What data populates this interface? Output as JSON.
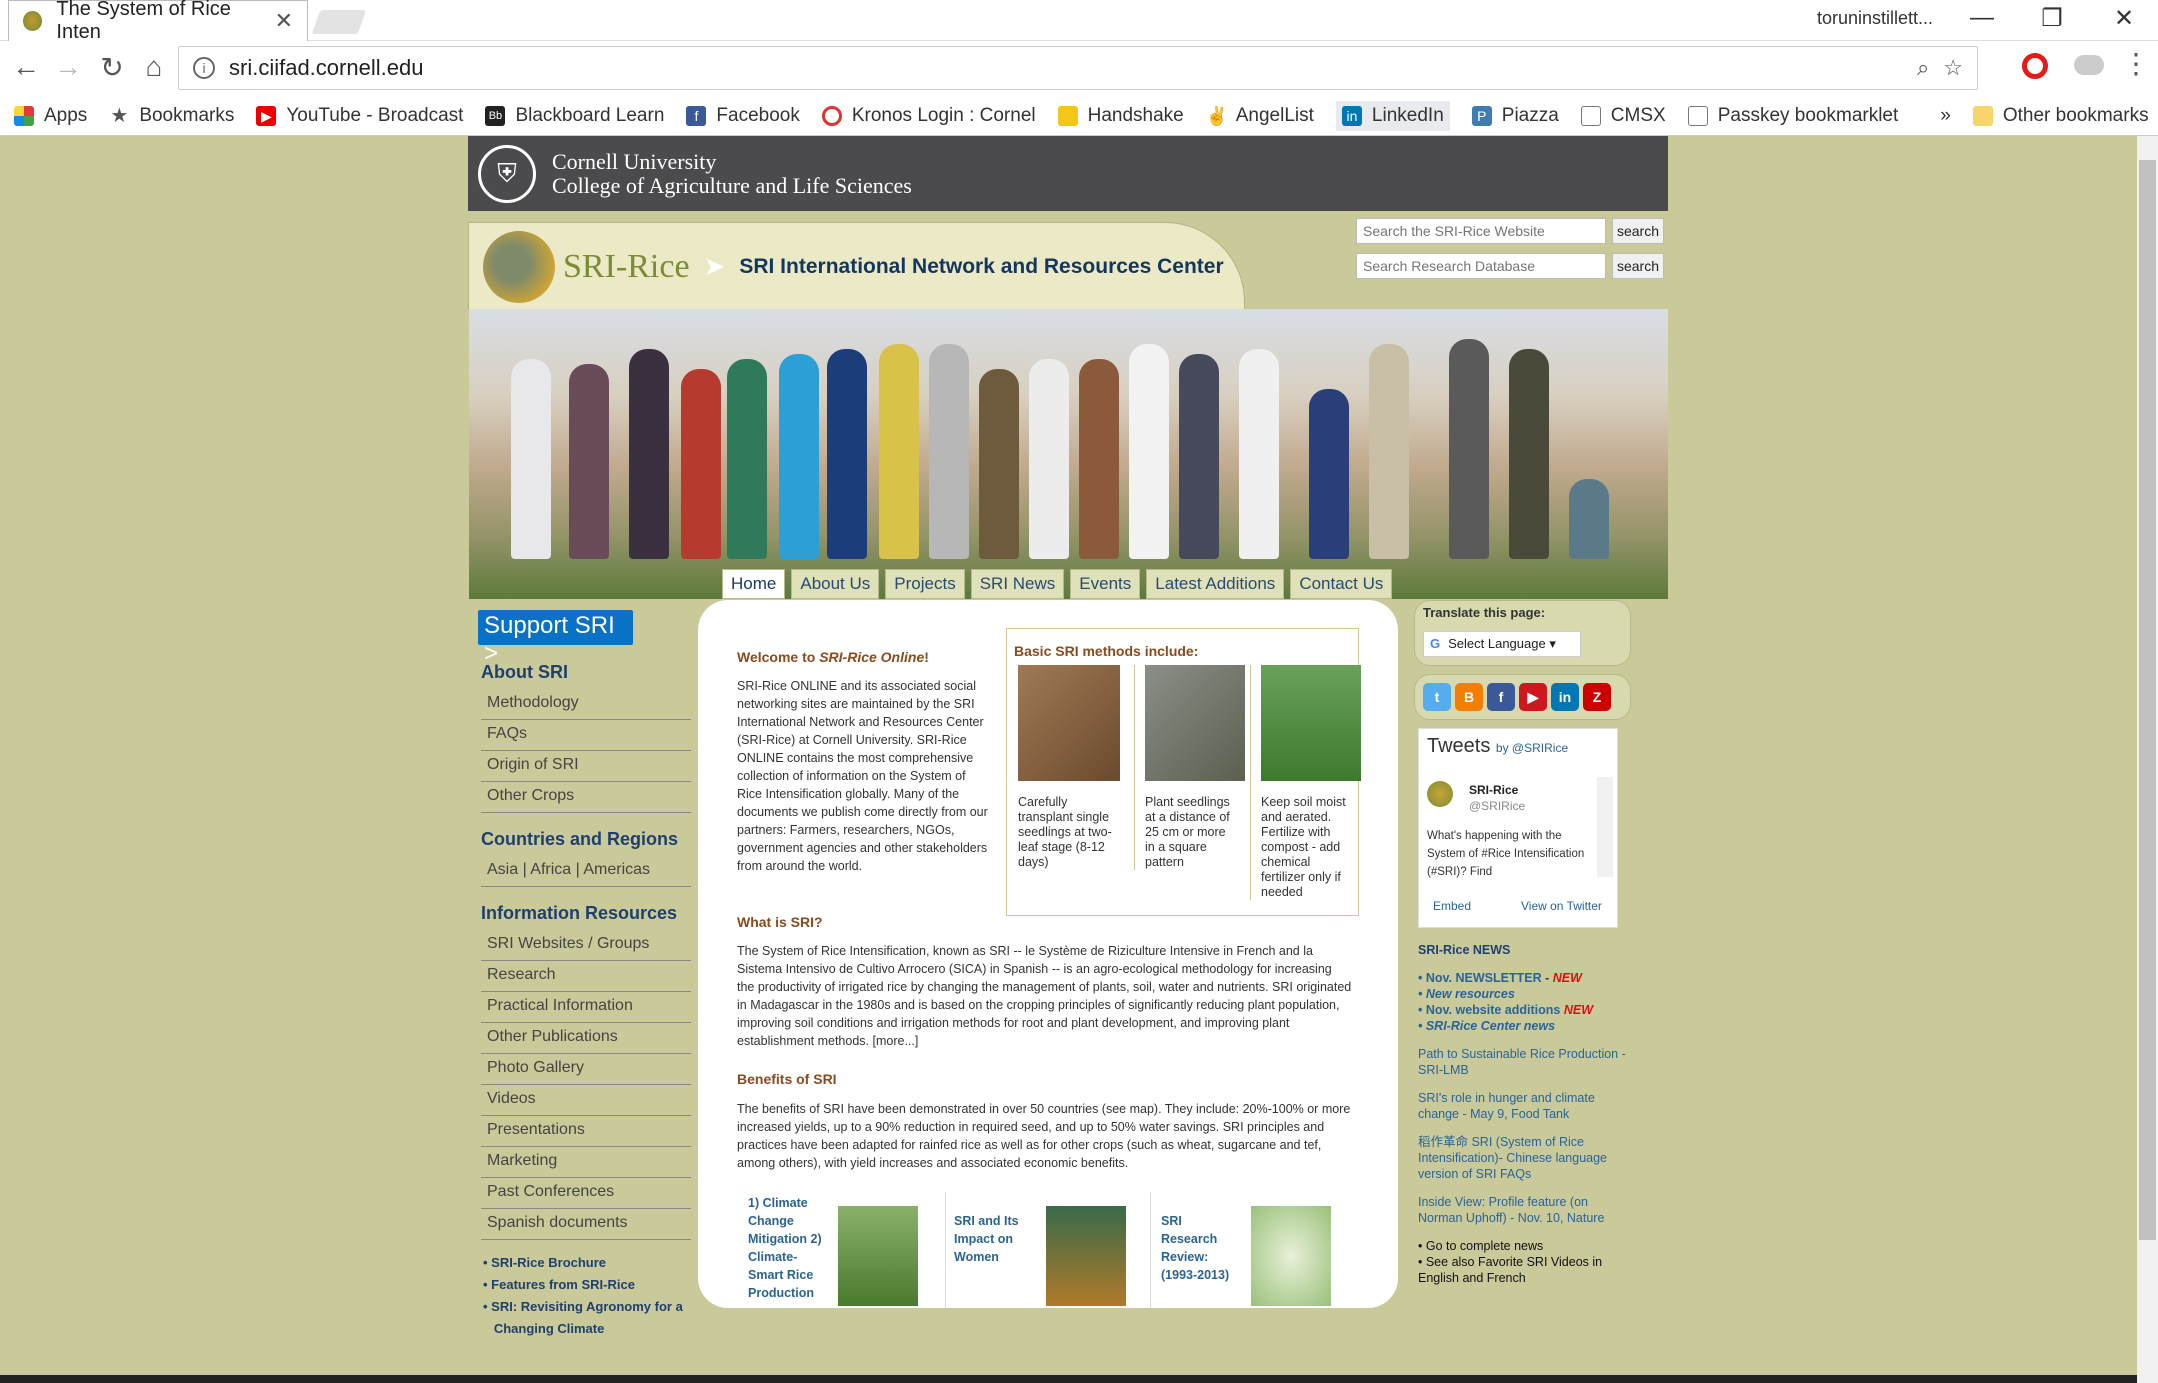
{
  "browser": {
    "tab_title": "The System of Rice Inten",
    "user": "toruninstillett...",
    "url": "sri.ciifad.cornell.edu",
    "bookmarks": [
      "Apps",
      "Bookmarks",
      "YouTube - Broadcast",
      "Blackboard Learn",
      "Facebook",
      "Kronos Login : Cornel",
      "Handshake",
      "AngelList",
      "LinkedIn",
      "Piazza",
      "CMSX",
      "Passkey bookmarklet"
    ],
    "other_bookmarks": "Other bookmarks"
  },
  "cornell": {
    "line1": "Cornell University",
    "line2": "College of Agriculture and Life Sciences"
  },
  "header": {
    "logo": "SRI-Rice",
    "title": "SRI International Network and Resources Center"
  },
  "search": {
    "site_placeholder": "Search the SRI-Rice Website",
    "db_placeholder": "Search Research Database",
    "button": "search"
  },
  "menu": [
    "Home",
    "About Us",
    "Projects",
    "SRI News",
    "Events",
    "Latest Additions",
    "Contact Us"
  ],
  "left": {
    "support": "Support SRI >",
    "about_head": "About SRI",
    "about_items": [
      "Methodology",
      "FAQs",
      "Origin of SRI",
      "Other Crops"
    ],
    "countries_head": "Countries and Regions",
    "countries_item": "Asia | Africa | Americas",
    "info_head": "Information Resources",
    "info_items": [
      "SRI Websites / Groups",
      "Research",
      "Practical Information",
      "Other Publications",
      "Photo Gallery",
      "Videos",
      "Presentations",
      "Marketing",
      "Past Conferences",
      "Spanish documents"
    ],
    "bullets": [
      "SRI-Rice Brochure",
      "Features from SRI-Rice",
      "SRI: Revisiting Agronomy for a",
      "Changing Climate"
    ]
  },
  "main": {
    "welcome_a": "Welcome to ",
    "welcome_b": "SRI-Rice Online",
    "welcome_c": "!",
    "intro": "SRI-Rice ONLINE and its associated social networking sites are maintained by the SRI International Network and Resources Center (SRI-Rice) at Cornell University. SRI-Rice ONLINE contains the most comprehensive collection of information on the System of Rice Intensification globally. Many of the documents we publish come directly from our partners: Farmers, researchers, NGOs, government agencies and other stakeholders from around the world.",
    "methods_head": "Basic SRI methods include:",
    "methods": [
      "Carefully transplant single seedlings at two-leaf stage (8-12 days)",
      "Plant seedlings at a distance of 25 cm or more in a square pattern",
      "Keep soil moist and aerated. Fertilize with compost - add chemical fertilizer only if needed"
    ],
    "what_head": "What is SRI?",
    "what_text": "The System of Rice Intensification, known as SRI -- le Système de Riziculture Intensive in French and la Sistema Intensivo de Cultivo Arrocero (SICA) in Spanish -- is an agro-ecological methodology for increasing the productivity of irrigated rice by changing the management of plants, soil, water and nutrients. SRI originated in Madagascar in the 1980s and is based on the cropping principles of significantly reducing plant population, improving soil conditions and irrigation methods for root and plant development, and improving plant establishment methods. [more...]",
    "benefits_head": "Benefits of SRI",
    "benefits_text": "The benefits of SRI have been demonstrated in over 50 countries (see map). They include: 20%-100% or more increased yields, up to a 90% reduction in required seed, and up to 50% water savings. SRI principles and practices have been adapted for rainfed rice as well as for other crops (such as wheat, sugarcane and tef, among others), with yield increases and associated economic benefits.",
    "cards": [
      "1) Climate Change Mitigation 2) Climate-Smart Rice Production",
      "SRI and Its Impact on Women",
      "SRI Research Review: (1993-2013)"
    ]
  },
  "right": {
    "translate_label": "Translate this page:",
    "select_language": "Select Language",
    "tweets_title": "Tweets",
    "tweets_by": "by @SRIRice",
    "tweet_name": "SRI-Rice",
    "tweet_handle": "@SRIRice",
    "tweet_text": "What's happening with the System of #Rice Intensification (#SRI)? Find",
    "embed": "Embed",
    "view_on_twitter": "View on Twitter",
    "news_head": "SRI-Rice NEWS",
    "news1": "• Nov. NEWSLETTER",
    "news2": "• New resources",
    "news3": "• Nov. website additions",
    "news4": "• SRI-Rice Center news",
    "new_tag": "NEW",
    "item1": "Path to Sustainable Rice Production - SRI-LMB",
    "item2": "SRI's role in hunger and climate change - May 9, Food Tank",
    "item3": "稻作革命 SRI (System of Rice Intensification)- Chinese language version of SRI FAQs",
    "item4": "Inside View: Profile feature (on Norman Uphoff) - Nov. 10, Nature",
    "goto": "• Go to complete news",
    "seealso": "• See also Favorite SRI Videos in English and French"
  }
}
